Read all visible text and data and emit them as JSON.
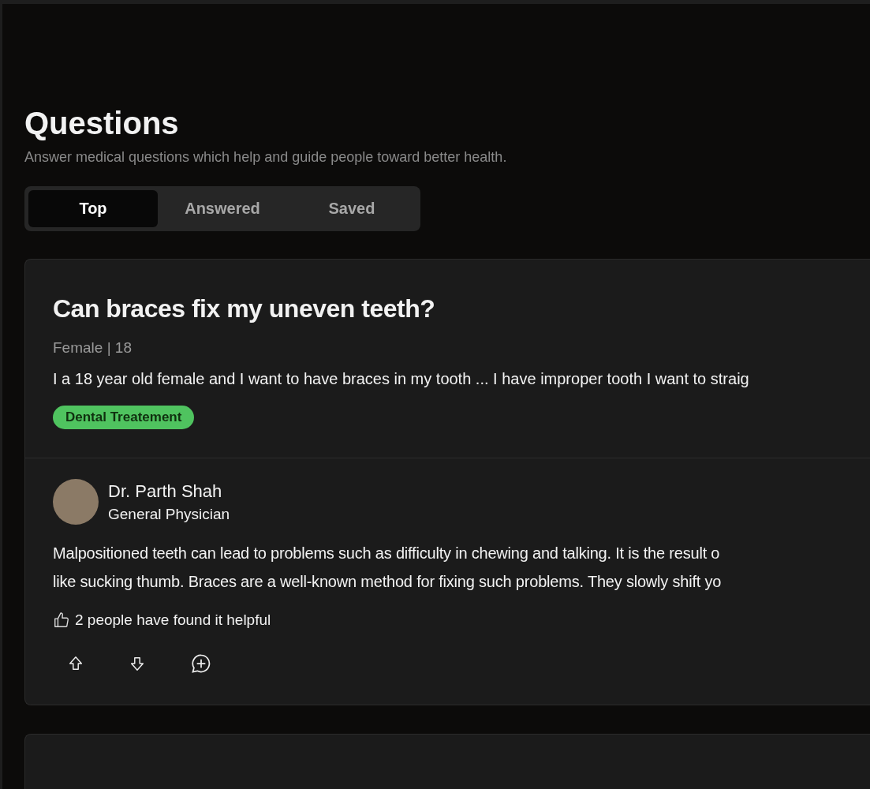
{
  "header": {
    "title": "Questions",
    "subtitle": "Answer medical questions which help and guide people toward better health."
  },
  "tabs": [
    {
      "label": "Top",
      "selected": true
    },
    {
      "label": "Answered",
      "selected": false
    },
    {
      "label": "Saved",
      "selected": false
    }
  ],
  "questions": [
    {
      "title": "Can braces fix my uneven teeth?",
      "meta": "Female | 18",
      "body": "I a 18 year old female and I want to have braces in my tooth ... I have improper tooth I want to straig",
      "tag": {
        "label": "Dental Treatement",
        "color": "#4fc35f"
      },
      "answer": {
        "doctor": "Dr. Parth Shah",
        "specialty": "General Physician",
        "lines": [
          "Malpositioned teeth can lead to problems such as difficulty in chewing and talking. It is the result o",
          "like sucking thumb. Braces are a well-known method for fixing such problems. They slowly shift yo"
        ],
        "helpful": "2 people have found it helpful"
      }
    }
  ]
}
